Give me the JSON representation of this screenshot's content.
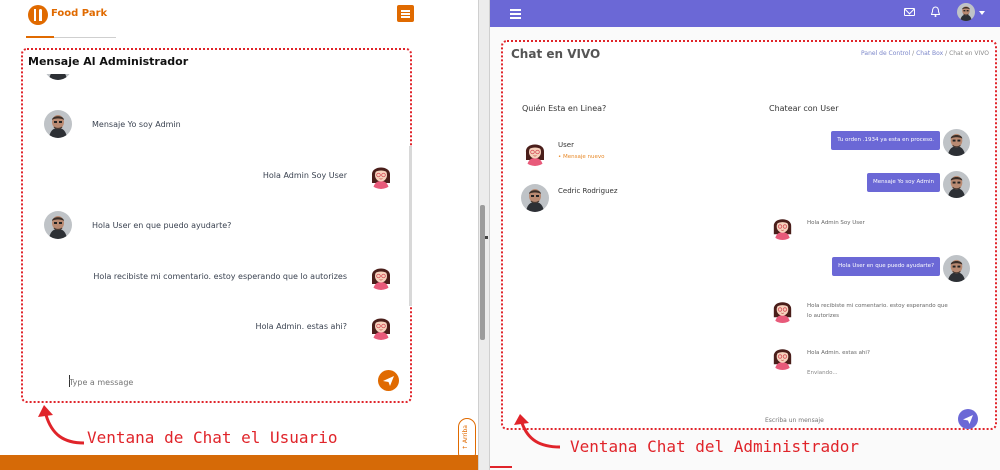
{
  "user_window": {
    "brand_name": "Food Park",
    "chat_title": "Mensaje Al Administrador",
    "messages": [
      {
        "from": "admin",
        "text": "Mensaje Yo soy Admin"
      },
      {
        "from": "user",
        "text": "Hola Admin Soy User"
      },
      {
        "from": "admin",
        "text": "Hola User en que puedo ayudarte?"
      },
      {
        "from": "user",
        "text": "Hola recibiste mi comentario. estoy esperando que lo autorizes"
      },
      {
        "from": "user",
        "text": "Hola Admin. estas ahi?"
      }
    ],
    "input_placeholder": "Type a message",
    "up_button_label": "↑ Arriba",
    "caption": "Ventana de Chat el Usuario"
  },
  "admin_window": {
    "page_title": "Chat en VIVO",
    "breadcrumb": [
      "Panel de Control",
      "Chat Box",
      "Chat en VIVO"
    ],
    "online_header": "Quién Esta en Linea?",
    "chat_with_header": "Chatear con User",
    "online_users": [
      {
        "name": "User",
        "status": "Mensaje nuevo",
        "avatar": "female-avatar"
      },
      {
        "name": "Cedric Rodriguez",
        "status": "",
        "avatar": "male-avatar"
      }
    ],
    "messages": [
      {
        "from": "admin",
        "text": "Tu orden .1934 ya esta en proceso."
      },
      {
        "from": "admin",
        "text": "Mensaje Yo soy Admin"
      },
      {
        "from": "user",
        "text": "Hola Admin Soy User"
      },
      {
        "from": "admin",
        "text": "Hola User en que puedo ayudarte?"
      },
      {
        "from": "user",
        "text": "Hola recibiste mi comentario. estoy esperando que lo autorizes"
      },
      {
        "from": "user",
        "text": "Hola Admin. estas ahi?"
      }
    ],
    "typing_status": "Enviando...",
    "input_placeholder": "Escriba un mensaje",
    "caption": "Ventana Chat del Administrador"
  },
  "colors": {
    "brand_orange": "#e06a00",
    "admin_purple": "#6b68d6",
    "annotation_red": "#e0242a"
  }
}
